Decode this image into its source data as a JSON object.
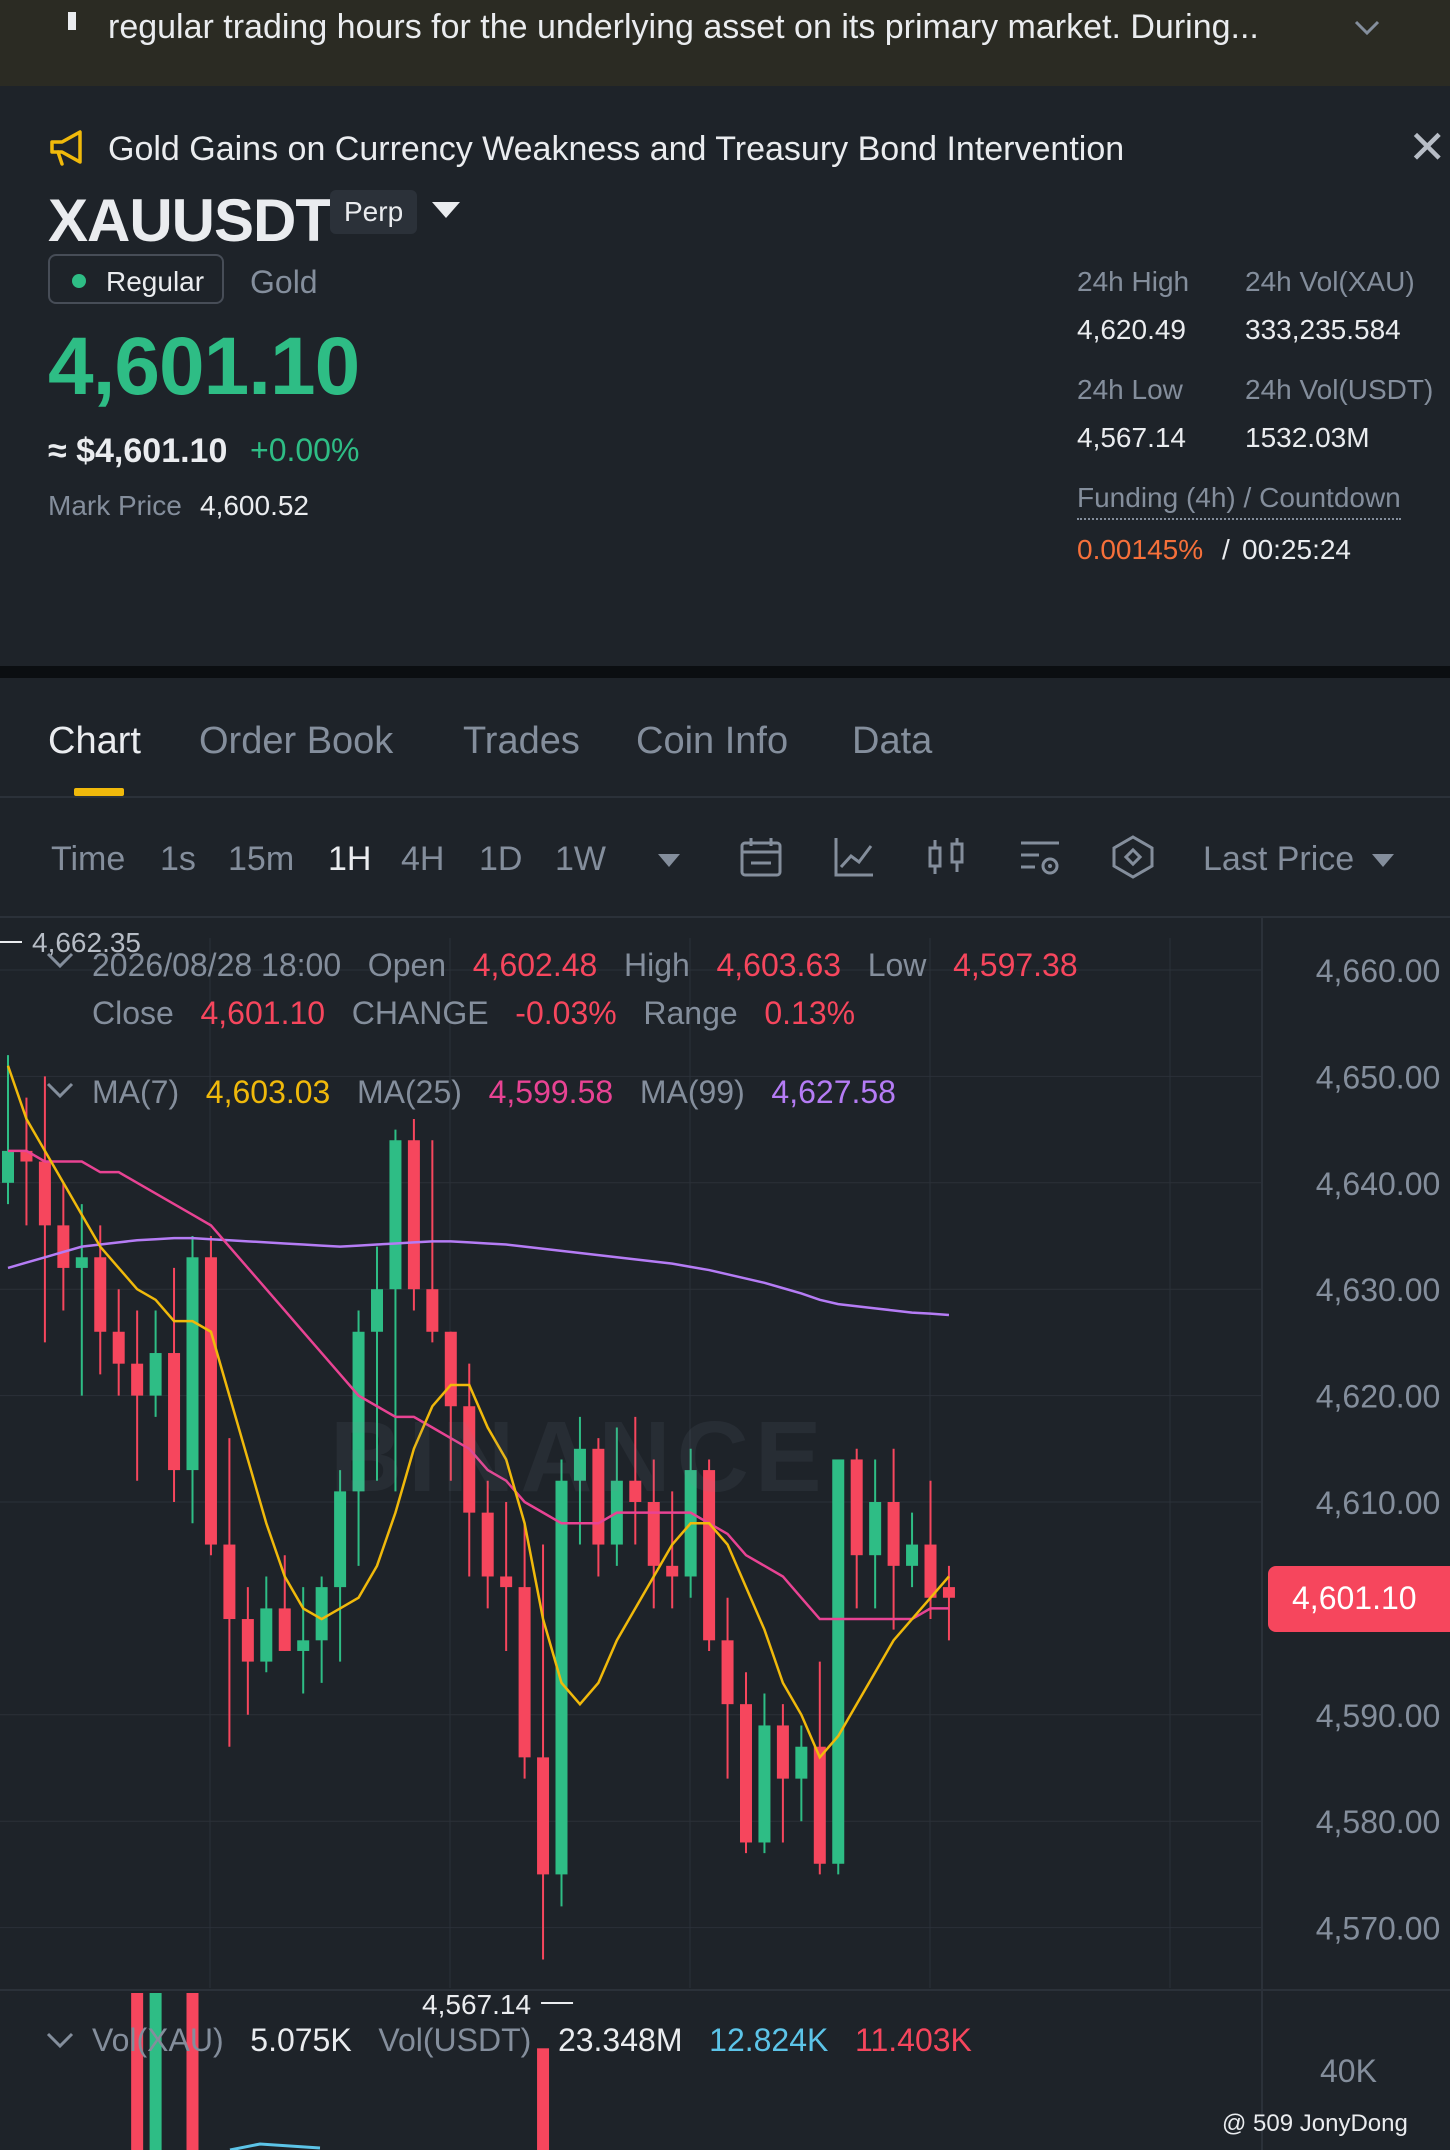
{
  "banner": {
    "text": "regular trading hours for the underlying asset on its primary market. During..."
  },
  "news": {
    "headline": "Gold Gains on Currency Weakness and Treasury Bond Intervention"
  },
  "ticker": {
    "symbol": "XAUUSDT",
    "contract": "Perp",
    "session": "Regular",
    "asset_name": "Gold",
    "last_price": "4,601.10",
    "approx_usd": "≈ $4,601.10",
    "change_pct": "+0.00%",
    "mark_price_label": "Mark Price",
    "mark_price": "4,600.52"
  },
  "stats": {
    "high_label": "24h High",
    "high": "4,620.49",
    "vol_xau_label": "24h Vol(XAU)",
    "vol_xau": "333,235.584",
    "low_label": "24h Low",
    "low": "4,567.14",
    "vol_usdt_label": "24h Vol(USDT)",
    "vol_usdt": "1532.03M",
    "funding_label": "Funding (4h) / Countdown",
    "funding_rate": "0.00145%",
    "funding_sep": "/",
    "countdown": "00:25:24"
  },
  "tabs": [
    "Chart",
    "Order Book",
    "Trades",
    "Coin Info",
    "Data"
  ],
  "timeframes": {
    "label": "Time",
    "items": [
      "1s",
      "15m",
      "1H",
      "4H",
      "1D",
      "1W"
    ],
    "active": "1H",
    "price_type": "Last Price"
  },
  "ohlc": {
    "date": "2026/08/28 18:00",
    "open_label": "Open",
    "open": "4,602.48",
    "high_label": "High",
    "high": "4,603.63",
    "low_label": "Low",
    "low": "4,597.38",
    "close_label": "Close",
    "close": "4,601.10",
    "change_label": "CHANGE",
    "change": "-0.03%",
    "range_label": "Range",
    "range": "0.13%"
  },
  "ma": {
    "ma7_label": "MA(7)",
    "ma7": "4,603.03",
    "ma25_label": "MA(25)",
    "ma25": "4,599.58",
    "ma99_label": "MA(99)",
    "ma99": "4,627.58"
  },
  "volume": {
    "xau_label": "Vol(XAU)",
    "xau": "5.075K",
    "usdt_label": "Vol(USDT)",
    "usdt": "23.348M",
    "ma_a": "12.824K",
    "ma_b": "11.403K",
    "axis_label": "40K"
  },
  "watermark": "BINANCE",
  "credit": "@ 509 JonyDong",
  "colors": {
    "up": "#2ebd85",
    "down": "#f6465d",
    "ma7": "#f0b90b",
    "ma25": "#e84393",
    "ma99": "#b57cf5"
  },
  "chart_data": {
    "type": "candlestick",
    "interval": "1H",
    "y_axis_ticks": [
      "4,660.00",
      "4,650.00",
      "4,640.00",
      "4,630.00",
      "4,620.00",
      "4,610.00",
      "4,590.00",
      "4,580.00",
      "4,570.00"
    ],
    "ylim": [
      4566,
      4662
    ],
    "current_price_label": "4,601.10",
    "current_price": 4601.1,
    "max_marker": "4,662.35",
    "min_marker": "4,567.14",
    "min_marker_index": 29,
    "candles": [
      {
        "o": 4640,
        "h": 4652,
        "l": 4638,
        "c": 4643
      },
      {
        "o": 4643,
        "h": 4648,
        "l": 4636,
        "c": 4642
      },
      {
        "o": 4642,
        "h": 4650,
        "l": 4625,
        "c": 4636
      },
      {
        "o": 4636,
        "h": 4640,
        "l": 4628,
        "c": 4632
      },
      {
        "o": 4632,
        "h": 4638,
        "l": 4620,
        "c": 4633
      },
      {
        "o": 4633,
        "h": 4636,
        "l": 4622,
        "c": 4626
      },
      {
        "o": 4626,
        "h": 4630,
        "l": 4620,
        "c": 4623
      },
      {
        "o": 4623,
        "h": 4628,
        "l": 4612,
        "c": 4620
      },
      {
        "o": 4620,
        "h": 4628,
        "l": 4618,
        "c": 4624
      },
      {
        "o": 4624,
        "h": 4632,
        "l": 4610,
        "c": 4613
      },
      {
        "o": 4613,
        "h": 4635,
        "l": 4608,
        "c": 4633
      },
      {
        "o": 4633,
        "h": 4635,
        "l": 4605,
        "c": 4606
      },
      {
        "o": 4606,
        "h": 4616,
        "l": 4587,
        "c": 4599
      },
      {
        "o": 4599,
        "h": 4602,
        "l": 4590,
        "c": 4595
      },
      {
        "o": 4595,
        "h": 4603,
        "l": 4594,
        "c": 4600
      },
      {
        "o": 4600,
        "h": 4605,
        "l": 4596,
        "c": 4596
      },
      {
        "o": 4596,
        "h": 4602,
        "l": 4592,
        "c": 4597
      },
      {
        "o": 4597,
        "h": 4603,
        "l": 4593,
        "c": 4602
      },
      {
        "o": 4602,
        "h": 4613,
        "l": 4595,
        "c": 4611
      },
      {
        "o": 4611,
        "h": 4628,
        "l": 4604,
        "c": 4626
      },
      {
        "o": 4626,
        "h": 4634,
        "l": 4612,
        "c": 4630
      },
      {
        "o": 4630,
        "h": 4645,
        "l": 4611,
        "c": 4644
      },
      {
        "o": 4644,
        "h": 4646,
        "l": 4628,
        "c": 4630
      },
      {
        "o": 4630,
        "h": 4644,
        "l": 4625,
        "c": 4626
      },
      {
        "o": 4626,
        "h": 4626,
        "l": 4612,
        "c": 4619
      },
      {
        "o": 4619,
        "h": 4623,
        "l": 4603,
        "c": 4609
      },
      {
        "o": 4609,
        "h": 4612,
        "l": 4600,
        "c": 4603
      },
      {
        "o": 4603,
        "h": 4610,
        "l": 4596,
        "c": 4602
      },
      {
        "o": 4602,
        "h": 4608,
        "l": 4584,
        "c": 4586
      },
      {
        "o": 4586,
        "h": 4606,
        "l": 4567,
        "c": 4575
      },
      {
        "o": 4575,
        "h": 4614,
        "l": 4572,
        "c": 4612
      },
      {
        "o": 4612,
        "h": 4618,
        "l": 4606,
        "c": 4615
      },
      {
        "o": 4615,
        "h": 4616,
        "l": 4603,
        "c": 4606
      },
      {
        "o": 4606,
        "h": 4617,
        "l": 4604,
        "c": 4612
      },
      {
        "o": 4612,
        "h": 4618,
        "l": 4606,
        "c": 4610
      },
      {
        "o": 4610,
        "h": 4614,
        "l": 4600,
        "c": 4604
      },
      {
        "o": 4604,
        "h": 4611,
        "l": 4600,
        "c": 4603
      },
      {
        "o": 4603,
        "h": 4615,
        "l": 4601,
        "c": 4613
      },
      {
        "o": 4613,
        "h": 4614,
        "l": 4596,
        "c": 4597
      },
      {
        "o": 4597,
        "h": 4601,
        "l": 4584,
        "c": 4591
      },
      {
        "o": 4591,
        "h": 4594,
        "l": 4577,
        "c": 4578
      },
      {
        "o": 4578,
        "h": 4592,
        "l": 4577,
        "c": 4589
      },
      {
        "o": 4589,
        "h": 4591,
        "l": 4578,
        "c": 4584
      },
      {
        "o": 4584,
        "h": 4589,
        "l": 4580,
        "c": 4587
      },
      {
        "o": 4587,
        "h": 4595,
        "l": 4575,
        "c": 4576
      },
      {
        "o": 4576,
        "h": 4614,
        "l": 4575,
        "c": 4614
      },
      {
        "o": 4614,
        "h": 4615,
        "l": 4600,
        "c": 4605
      },
      {
        "o": 4605,
        "h": 4614,
        "l": 4600,
        "c": 4610
      },
      {
        "o": 4610,
        "h": 4615,
        "l": 4598,
        "c": 4604
      },
      {
        "o": 4604,
        "h": 4609,
        "l": 4602,
        "c": 4606
      },
      {
        "o": 4606,
        "h": 4612,
        "l": 4599,
        "c": 4601
      },
      {
        "o": 4602,
        "h": 4604,
        "l": 4597,
        "c": 4601
      }
    ],
    "ma7": [
      4651,
      4646,
      4643,
      4640,
      4637,
      4634,
      4632,
      4630,
      4629,
      4627,
      4627,
      4626,
      4620,
      4614,
      4608,
      4603,
      4600,
      4599,
      4600,
      4601,
      4604,
      4609,
      4615,
      4619,
      4621,
      4621,
      4617,
      4614,
      4608,
      4599,
      4593,
      4591,
      4593,
      4597,
      4600,
      4603,
      4606,
      4608,
      4608,
      4606,
      4602,
      4598,
      4593,
      4590,
      4586,
      4588,
      4591,
      4594,
      4597,
      4599,
      4601,
      4603
    ],
    "ma25": [
      4643,
      4643,
      4642,
      4642,
      4642,
      4641,
      4641,
      4640,
      4639,
      4638,
      4637,
      4636,
      4634,
      4632,
      4630,
      4628,
      4626,
      4624,
      4622,
      4620,
      4619,
      4618,
      4618,
      4617,
      4616,
      4615,
      4613,
      4612,
      4610,
      4609,
      4608,
      4608,
      4608,
      4609,
      4609,
      4609,
      4609,
      4609,
      4608,
      4607,
      4605,
      4604,
      4603,
      4601,
      4599,
      4599,
      4599,
      4599,
      4599,
      4599,
      4600,
      4600
    ],
    "ma99": [
      4632,
      4632.5,
      4633,
      4633.5,
      4634,
      4634.2,
      4634.4,
      4634.6,
      4634.7,
      4634.8,
      4634.8,
      4634.7,
      4634.6,
      4634.5,
      4634.4,
      4634.3,
      4634.2,
      4634.1,
      4634.0,
      4634.1,
      4634.2,
      4634.3,
      4634.4,
      4634.5,
      4634.5,
      4634.4,
      4634.3,
      4634.2,
      4634.0,
      4633.8,
      4633.6,
      4633.4,
      4633.2,
      4633.0,
      4632.8,
      4632.6,
      4632.4,
      4632.1,
      4631.8,
      4631.4,
      4631.0,
      4630.6,
      4630.1,
      4629.6,
      4629.0,
      4628.6,
      4628.4,
      4628.2,
      4628.0,
      4627.8,
      4627.7,
      4627.58
    ],
    "volume_bars": [
      {
        "i": 7,
        "v": 1.0,
        "dir": "down"
      },
      {
        "i": 8,
        "v": 1.0,
        "dir": "up"
      },
      {
        "i": 10,
        "v": 1.0,
        "dir": "down"
      },
      {
        "i": 29,
        "v": 0.65,
        "dir": "down"
      }
    ]
  }
}
